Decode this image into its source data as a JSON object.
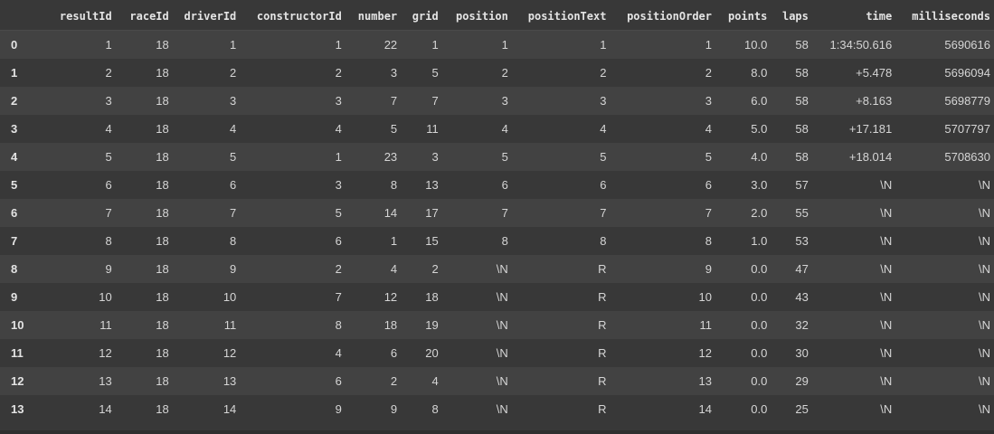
{
  "table": {
    "columns": [
      "",
      "resultId",
      "raceId",
      "driverId",
      "constructorId",
      "number",
      "grid",
      "position",
      "positionText",
      "positionOrder",
      "points",
      "laps",
      "time",
      "milliseconds"
    ],
    "rows": [
      [
        "0",
        "1",
        "18",
        "1",
        "1",
        "22",
        "1",
        "1",
        "1",
        "1",
        "10.0",
        "58",
        "1:34:50.616",
        "5690616"
      ],
      [
        "1",
        "2",
        "18",
        "2",
        "2",
        "3",
        "5",
        "2",
        "2",
        "2",
        "8.0",
        "58",
        "+5.478",
        "5696094"
      ],
      [
        "2",
        "3",
        "18",
        "3",
        "3",
        "7",
        "7",
        "3",
        "3",
        "3",
        "6.0",
        "58",
        "+8.163",
        "5698779"
      ],
      [
        "3",
        "4",
        "18",
        "4",
        "4",
        "5",
        "11",
        "4",
        "4",
        "4",
        "5.0",
        "58",
        "+17.181",
        "5707797"
      ],
      [
        "4",
        "5",
        "18",
        "5",
        "1",
        "23",
        "3",
        "5",
        "5",
        "5",
        "4.0",
        "58",
        "+18.014",
        "5708630"
      ],
      [
        "5",
        "6",
        "18",
        "6",
        "3",
        "8",
        "13",
        "6",
        "6",
        "6",
        "3.0",
        "57",
        "\\N",
        "\\N"
      ],
      [
        "6",
        "7",
        "18",
        "7",
        "5",
        "14",
        "17",
        "7",
        "7",
        "7",
        "2.0",
        "55",
        "\\N",
        "\\N"
      ],
      [
        "7",
        "8",
        "18",
        "8",
        "6",
        "1",
        "15",
        "8",
        "8",
        "8",
        "1.0",
        "53",
        "\\N",
        "\\N"
      ],
      [
        "8",
        "9",
        "18",
        "9",
        "2",
        "4",
        "2",
        "\\N",
        "R",
        "9",
        "0.0",
        "47",
        "\\N",
        "\\N"
      ],
      [
        "9",
        "10",
        "18",
        "10",
        "7",
        "12",
        "18",
        "\\N",
        "R",
        "10",
        "0.0",
        "43",
        "\\N",
        "\\N"
      ],
      [
        "10",
        "11",
        "18",
        "11",
        "8",
        "18",
        "19",
        "\\N",
        "R",
        "11",
        "0.0",
        "32",
        "\\N",
        "\\N"
      ],
      [
        "11",
        "12",
        "18",
        "12",
        "4",
        "6",
        "20",
        "\\N",
        "R",
        "12",
        "0.0",
        "30",
        "\\N",
        "\\N"
      ],
      [
        "12",
        "13",
        "18",
        "13",
        "6",
        "2",
        "4",
        "\\N",
        "R",
        "13",
        "0.0",
        "29",
        "\\N",
        "\\N"
      ],
      [
        "13",
        "14",
        "18",
        "14",
        "9",
        "9",
        "8",
        "\\N",
        "R",
        "14",
        "0.0",
        "25",
        "\\N",
        "\\N"
      ]
    ]
  },
  "colors": {
    "background": "#383838",
    "row_alt": "#424242",
    "text": "#d5d5d5"
  }
}
